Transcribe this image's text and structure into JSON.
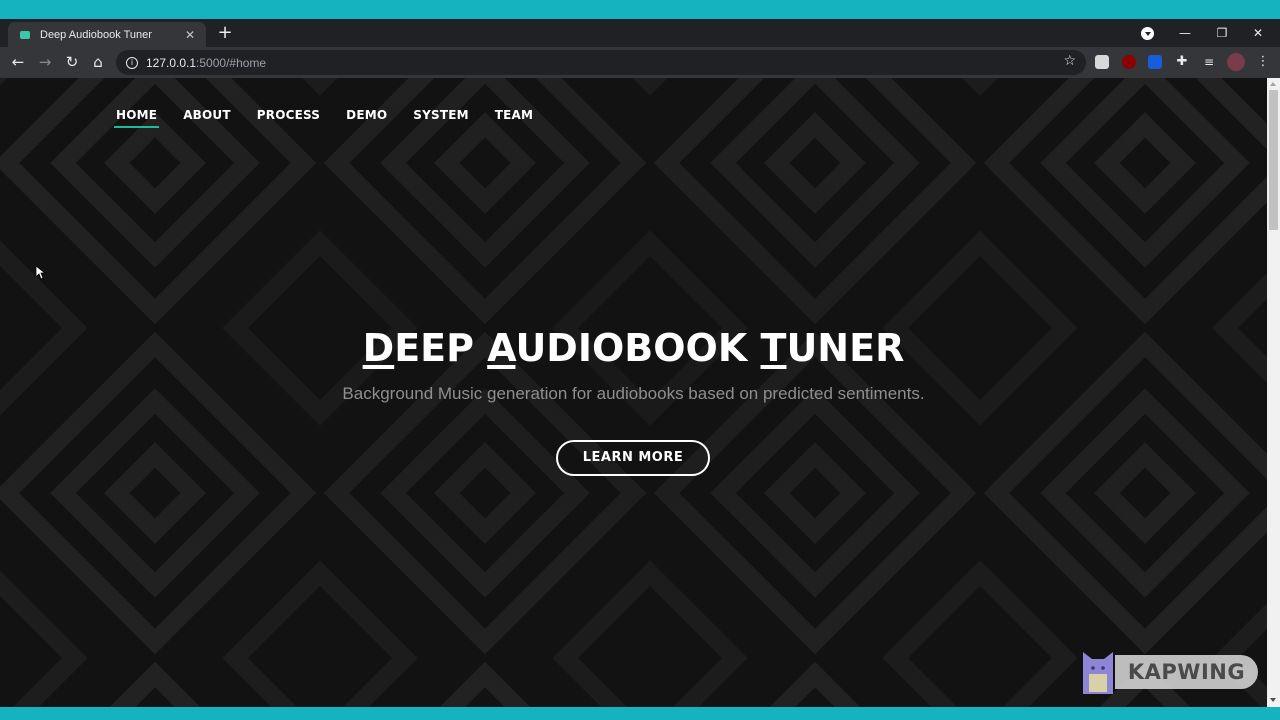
{
  "browser": {
    "tab_title": "Deep Audiobook Tuner",
    "tab_close": "✕",
    "new_tab": "+",
    "url_host": "127.0.0.1",
    "url_rest": ":5000/#home",
    "window_controls": {
      "minimize": "—",
      "maximize": "❐",
      "close": "✕"
    }
  },
  "nav": {
    "items": [
      {
        "label": "HOME",
        "active": true
      },
      {
        "label": "ABOUT",
        "active": false
      },
      {
        "label": "PROCESS",
        "active": false
      },
      {
        "label": "DEMO",
        "active": false
      },
      {
        "label": "SYSTEM",
        "active": false
      },
      {
        "label": "TEAM",
        "active": false
      }
    ]
  },
  "hero": {
    "title_parts": [
      {
        "text": "D",
        "underline": true
      },
      {
        "text": "EEP ",
        "underline": false
      },
      {
        "text": "A",
        "underline": true
      },
      {
        "text": "UDIOBOOK ",
        "underline": false
      },
      {
        "text": "T",
        "underline": true
      },
      {
        "text": "UNER",
        "underline": false
      }
    ],
    "subtitle": "Background Music generation for audiobooks based on predicted sentiments.",
    "button_label": "LEARN MORE"
  },
  "watermark": {
    "text": "KAPWING"
  },
  "colors": {
    "accent": "#1abc9c",
    "frame": "#15b3c0",
    "page_bg": "#121212"
  }
}
